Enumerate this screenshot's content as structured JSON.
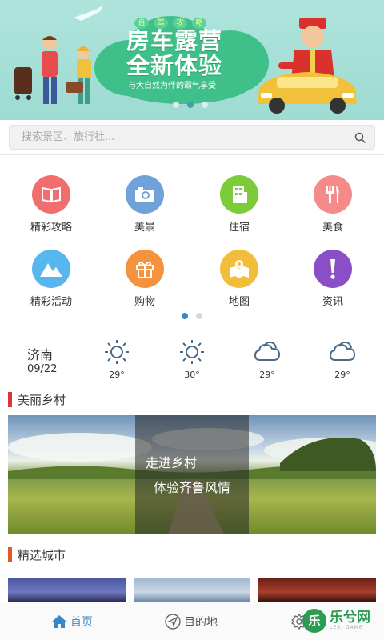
{
  "banner": {
    "tags": [
      "自",
      "驾",
      "攻",
      "略"
    ],
    "title_line1": "房车露营",
    "title_line2": "全新体验",
    "subtitle": "与大自然为伴的霸气享受"
  },
  "search": {
    "placeholder": "搜索景区、旅行社..."
  },
  "categories": [
    {
      "label": "精彩攻略",
      "color": "#f26d6d",
      "icon": "book-icon"
    },
    {
      "label": "美景",
      "color": "#6fa2d8",
      "icon": "camera-icon"
    },
    {
      "label": "住宿",
      "color": "#7ccb3b",
      "icon": "building-icon"
    },
    {
      "label": "美食",
      "color": "#f58a8a",
      "icon": "fork-knife-icon"
    },
    {
      "label": "精彩活动",
      "color": "#58b6ee",
      "icon": "mountain-icon"
    },
    {
      "label": "购物",
      "color": "#f5923e",
      "icon": "gift-icon"
    },
    {
      "label": "地图",
      "color": "#f3bd3c",
      "icon": "map-icon"
    },
    {
      "label": "资讯",
      "color": "#8a4fc7",
      "icon": "exclamation-icon"
    }
  ],
  "weather": {
    "city": "济南",
    "date": "09/22",
    "days": [
      {
        "icon": "sun-icon",
        "temp": "29°"
      },
      {
        "icon": "sun-icon",
        "temp": "30°"
      },
      {
        "icon": "cloud-icon",
        "temp": "29°"
      },
      {
        "icon": "cloud-icon",
        "temp": "29°"
      }
    ]
  },
  "sections": {
    "village": {
      "title": "美丽乡村",
      "accent": "#d9363e",
      "caption_line1": "走进乡村",
      "caption_line2": "体验齐鲁风情"
    },
    "city": {
      "title": "精选城市",
      "accent": "#e05a2a"
    }
  },
  "tabbar": {
    "home": "首页",
    "destination": "目的地",
    "active_color": "#3a86c5"
  },
  "watermark": {
    "brand": "乐兮网",
    "sub": "LEXI GAME"
  }
}
